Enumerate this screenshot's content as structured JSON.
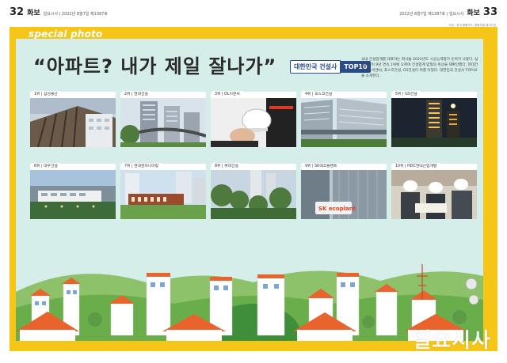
{
  "header": {
    "left_page": "32",
    "left_section": "화보",
    "left_meta": "일요시사 | 2022년 8월7일 제1387호",
    "right_meta": "2022년 8월7일 제1387호 | 일요시사",
    "right_section": "화보",
    "right_page": "33",
    "credit": "사진 : 한국 종합가드, 광동자원 제1차 참"
  },
  "section_label": "special photo",
  "headline": "“아파트? 내가 제일 잘나가”",
  "badge": {
    "main": "대한민국 건설사",
    "highlight": "TOP10"
  },
  "description": "국내 건설업계를 대표하는 회사들 2022년도 시공능력평가 순위가 나왔다. 삼성물산이 9년 연속 1위에 오르며 건설업계 맏형의 위상을 재확인했다. 현대건설, DL이앤씨, 포스코건설, GS건설이 뒤를 이었다. 대한민국 건설사 TOP10을 소개한다.",
  "companies": [
    {
      "rank_label": "1위 | 삼성물산"
    },
    {
      "rank_label": "2위 | 현대건설"
    },
    {
      "rank_label": "3위 | DL이앤씨"
    },
    {
      "rank_label": "4위 | 포스코건설"
    },
    {
      "rank_label": "5위 | GS건설"
    },
    {
      "rank_label": "6위 | 대우건설"
    },
    {
      "rank_label": "7위 | 현대엔지니어링"
    },
    {
      "rank_label": "8위 | 롯데건설"
    },
    {
      "rank_label": "9위 | SK에코플랜트"
    },
    {
      "rank_label": "10위 | HDC현대산업개발"
    }
  ],
  "sk_sign": "SK ecoplant",
  "watermark": "일요시사",
  "colors": {
    "frame": "#f5c518",
    "panel": "#d6eeea",
    "badge": "#2a4a8a"
  }
}
